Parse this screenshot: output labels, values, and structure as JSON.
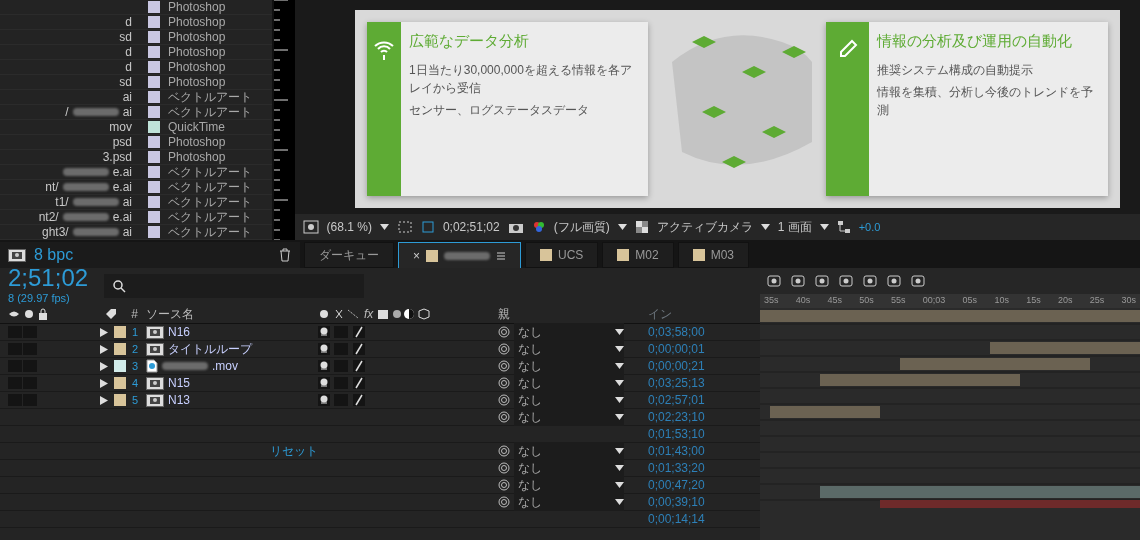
{
  "project": {
    "items": [
      {
        "type": "Photoshop",
        "color": "#c9c7e2"
      },
      {
        "name": "d",
        "type": "Photoshop",
        "color": "#c9c7e2"
      },
      {
        "name": "sd",
        "type": "Photoshop",
        "color": "#c9c7e2"
      },
      {
        "name": "d",
        "type": "Photoshop",
        "color": "#c9c7e2"
      },
      {
        "name": "d",
        "type": "Photoshop",
        "color": "#c9c7e2"
      },
      {
        "name": "sd",
        "type": "Photoshop",
        "color": "#c9c7e2"
      },
      {
        "name": "ai",
        "type": "ベクトルアート",
        "color": "#c9c7e2"
      },
      {
        "name": "/",
        "blurred": true,
        "suffix": "ai",
        "type": "ベクトルアート",
        "color": "#c9c7e2"
      },
      {
        "name": "mov",
        "type": "QuickTime",
        "color": "#bfe2d8"
      },
      {
        "name": "psd",
        "type": "Photoshop",
        "color": "#c9c7e2"
      },
      {
        "name": "3.psd",
        "type": "Photoshop",
        "color": "#c9c7e2"
      },
      {
        "blurred": true,
        "suffix": "e.ai",
        "type": "ベクトルアート",
        "color": "#c9c7e2"
      },
      {
        "name": "nt/",
        "blurred": true,
        "suffix": "e.ai",
        "type": "ベクトルアート",
        "color": "#c9c7e2"
      },
      {
        "name": "t1/",
        "blurred": true,
        "suffix": "ai",
        "type": "ベクトルアート",
        "color": "#c9c7e2"
      },
      {
        "name": "nt2/",
        "blurred": true,
        "suffix": "e.ai",
        "type": "ベクトルアート",
        "color": "#c9c7e2"
      },
      {
        "name": "ght3/",
        "blurred": true,
        "suffix": "ai",
        "type": "ベクトルアート",
        "color": "#c9c7e2"
      }
    ],
    "bpc": "8 bpc"
  },
  "viewer": {
    "cards": [
      {
        "title": "広範なデータ分析",
        "bullets": [
          "1日当たり30,000,000を超える情報を各アレイから受信",
          "センサー、ログステータスデータ"
        ]
      },
      {
        "title": "情報の分析及び運用の自動化",
        "bullets": [
          "推奨システム構成の自動提示",
          "情報を集積、分析し今後のトレンドを予測"
        ]
      }
    ],
    "toolbar": {
      "zoom": "(68.1 %)",
      "timecode": "0;02;51;02",
      "resolution": "(フル画質)",
      "camera": "アクティブカメラ",
      "views": "1 画面",
      "exposure": "+0.0"
    }
  },
  "tabs": [
    {
      "label": "ダーキュー",
      "selected": false
    },
    {
      "blurred": true,
      "color": "#d8c49a",
      "close": "×",
      "selected": true
    },
    {
      "label": "UCS",
      "color": "#d8c49a",
      "selected": false
    },
    {
      "label": "M02",
      "color": "#d8c49a",
      "selected": false
    },
    {
      "label": "M03",
      "color": "#d8c49a",
      "selected": false
    }
  ],
  "timeline": {
    "timecode": "2;51;02",
    "fps": "8 (29.97 fps)",
    "columns": {
      "number": "#",
      "source": "ソース名",
      "effects": "fx",
      "parent": "親",
      "in": "イン"
    },
    "ruler": [
      "35s",
      "40s",
      "45s",
      "50s",
      "55s",
      "00;03",
      "05s",
      "10s",
      "15s",
      "20s",
      "25s",
      "30s"
    ],
    "rows": [
      {
        "number": "1",
        "color": "#d8c49a",
        "name": "N16",
        "kind": "footage",
        "parent": "なし",
        "in": "0;03;58;00"
      },
      {
        "number": "2",
        "color": "#d8c49a",
        "name": "タイトルループ",
        "kind": "footage",
        "parent": "なし",
        "in": "0;00;00;01"
      },
      {
        "number": "3",
        "color": "#d3ecea",
        "blurred": true,
        "name": ".mov",
        "kind": "ai",
        "parent": "なし",
        "in": "0;00;00;21"
      },
      {
        "number": "4",
        "color": "#d8c49a",
        "name": "N15",
        "kind": "footage",
        "parent": "なし",
        "in": "0;03;25;13"
      },
      {
        "number": "5",
        "color": "#d8c49a",
        "name": "N13",
        "kind": "footage",
        "parent": "なし",
        "in": "0;02;57;01"
      },
      {
        "parent": "なし",
        "in": "0;02;23;10"
      },
      {
        "in": "0;01;53;10"
      },
      {
        "reset": "リセット",
        "parent": "なし",
        "in": "0;01;43;00"
      },
      {
        "parent": "なし",
        "in": "0;01;33;20"
      },
      {
        "parent": "なし",
        "in": "0;00;47;20"
      },
      {
        "parent": "なし",
        "in": "0;00;39;10"
      },
      {
        "in": "0;00;14;14"
      }
    ]
  }
}
